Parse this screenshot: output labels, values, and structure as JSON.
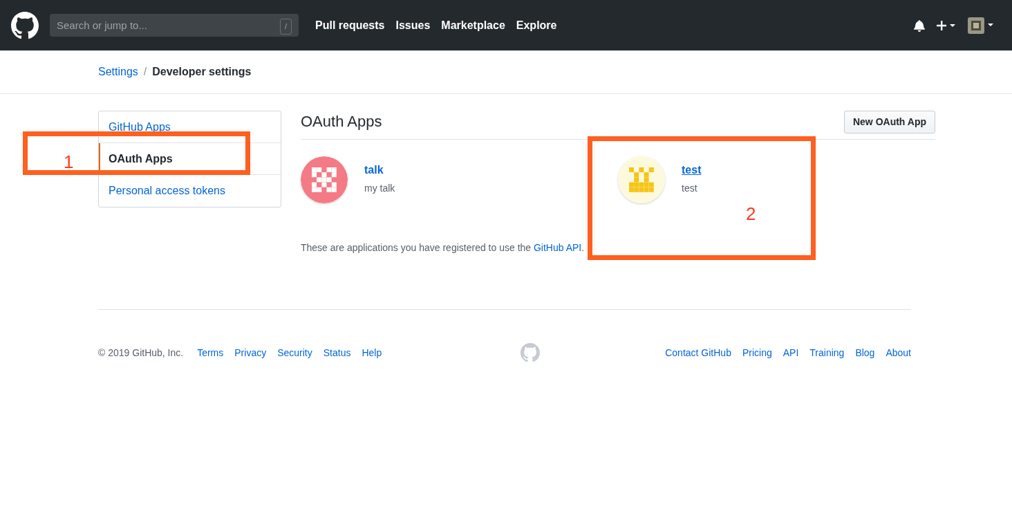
{
  "header": {
    "search": {
      "placeholder": "Search or jump to...",
      "shortcut": "/"
    },
    "nav": [
      "Pull requests",
      "Issues",
      "Marketplace",
      "Explore"
    ]
  },
  "breadcrumb": {
    "parent": "Settings",
    "separator": "/",
    "current": "Developer settings"
  },
  "sidebar": {
    "items": [
      {
        "label": "GitHub Apps",
        "selected": false
      },
      {
        "label": "OAuth Apps",
        "selected": true
      },
      {
        "label": "Personal access tokens",
        "selected": false
      }
    ]
  },
  "main": {
    "title": "OAuth Apps",
    "new_button": "New OAuth App",
    "apps": [
      {
        "name": "talk",
        "description": "my talk",
        "color": "#f47a85",
        "kind": "cross",
        "hovered": false
      },
      {
        "name": "test",
        "description": "test",
        "color": "#f5c518",
        "kind": "tower",
        "hovered": true
      }
    ],
    "note": {
      "text": "These are applications you have registered to use the ",
      "link": "GitHub API",
      "end": "."
    }
  },
  "footer": {
    "copyright": "© 2019 GitHub, Inc.",
    "left_links": [
      "Terms",
      "Privacy",
      "Security",
      "Status",
      "Help"
    ],
    "right_links": [
      "Contact GitHub",
      "Pricing",
      "API",
      "Training",
      "Blog",
      "About"
    ]
  },
  "annotations": [
    {
      "label": "1"
    },
    {
      "label": "2"
    }
  ]
}
